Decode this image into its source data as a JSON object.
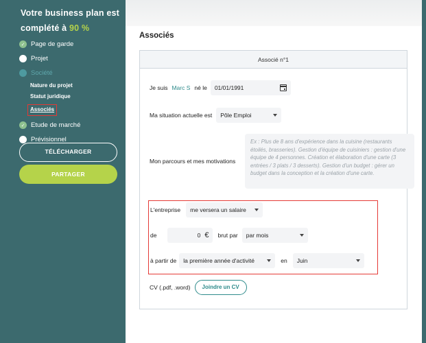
{
  "sidebar": {
    "progress_text": "Votre business plan est complété à",
    "progress_pct": "90 %",
    "items": [
      {
        "label": "Page de garde",
        "state": "done"
      },
      {
        "label": "Projet",
        "state": "todo"
      },
      {
        "label": "Société",
        "state": "active"
      },
      {
        "label": "Etude de marché",
        "state": "done"
      },
      {
        "label": "Prévisionnel",
        "state": "todo"
      }
    ],
    "subitems": [
      "Nature du projet",
      "Statut juridique",
      "Associés"
    ],
    "download_label": "TÉLÉCHARGER",
    "share_label": "PARTAGER"
  },
  "main": {
    "section_title": "Associés",
    "card_header": "Associé n°1",
    "je_suis_label": "Je suis",
    "name": "Marc S",
    "ne_le_label": "né le",
    "birthdate": "01/01/1991",
    "situation_label": "Ma situation actuelle est",
    "situation_value": "Pôle Emploi",
    "motivations_label": "Mon parcours et mes motivations",
    "motivations_placeholder": "Ex : Plus de 8 ans d'expérience dans la cuisine (restaurants étoilés, brasseries). Gestion d'équipe de cuisiniers : gestion d'une équipe de 4 personnes. Création et élaboration d'une carte (3 entrées / 3 plats / 3 desserts). Gestion d'un budget : gérer un budget dans la conception et la création d'une carte.",
    "entreprise_label": "L'entreprise",
    "entreprise_value": "me versera un salaire",
    "de_label": "de",
    "amount_value": "0",
    "currency": "€",
    "brut_par_label": "brut par",
    "period_value": "par mois",
    "a_partir_label": "à partir de",
    "start_value": "la première année d'activité",
    "en_label": "en",
    "month_value": "Juin",
    "cv_label": "CV (.pdf, .word)",
    "cv_button": "Joindre un CV"
  },
  "colors": {
    "sidebar_bg": "#3c6a6e",
    "accent_green": "#b5d34a",
    "teal": "#2e8b8b",
    "highlight_red": "#e53935"
  }
}
